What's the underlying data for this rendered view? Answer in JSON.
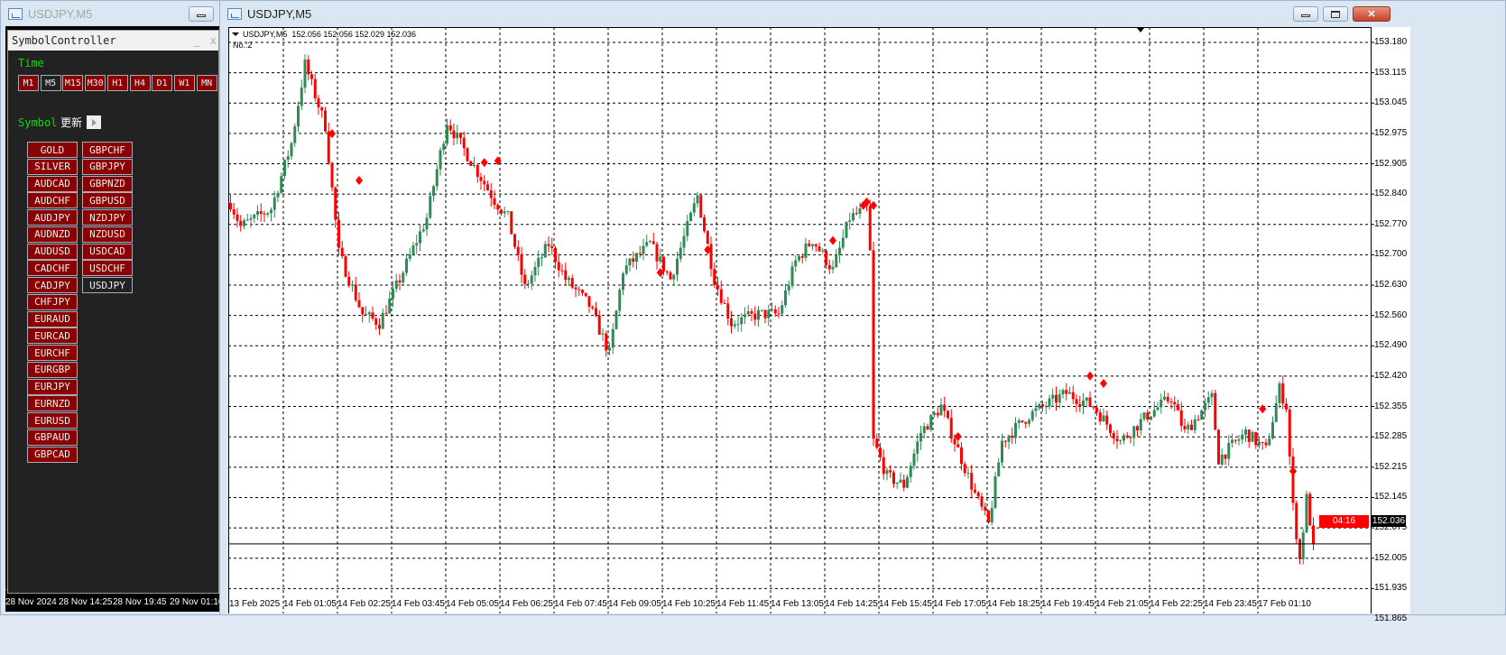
{
  "left_window": {
    "title": "USDJPY,M5",
    "time_labels": [
      "28 Nov 2024",
      "28 Nov 14:25",
      "28 Nov 19:45",
      "29 Nov 01:10"
    ]
  },
  "symbol_controller": {
    "title": "SymbolController",
    "minimize": "_",
    "close": "x",
    "time_label": "Time",
    "timeframes": [
      "M1",
      "M5",
      "M15",
      "M30",
      "H1",
      "H4",
      "D1",
      "W1",
      "MN"
    ],
    "selected_timeframe": "M5",
    "symbol_label": "Symbol",
    "refresh_label": "更新",
    "symbols_col1": [
      "GOLD",
      "SILVER",
      "AUDCAD",
      "AUDCHF",
      "AUDJPY",
      "AUDNZD",
      "AUDUSD",
      "CADCHF",
      "CADJPY",
      "CHFJPY",
      "EURAUD",
      "EURCAD",
      "EURCHF",
      "EURGBP",
      "EURJPY",
      "EURNZD",
      "EURUSD",
      "GBPAUD",
      "GBPCAD"
    ],
    "symbols_col2": [
      "GBPCHF",
      "GBPJPY",
      "GBPNZD",
      "GBPUSD",
      "NZDJPY",
      "NZDUSD",
      "USDCAD",
      "USDCHF",
      "USDJPY"
    ],
    "selected_symbol": "USDJPY"
  },
  "main_window": {
    "title": "USDJPY,M5"
  },
  "chart_data": {
    "type": "candlestick",
    "header": "USDJPY,M5  152.056 152.056 152.029 152.036",
    "sub_header": "No.:2",
    "symbol": "USDJPY",
    "timeframe": "M5",
    "ohlc_last": {
      "open": 152.056,
      "high": 152.056,
      "low": 152.029,
      "close": 152.036
    },
    "current_price": "152.036",
    "countdown": "04:16",
    "grid": true,
    "ylim": [
      151.865,
      153.18
    ],
    "y_ticks": [
      "153.180",
      "153.115",
      "153.045",
      "152.975",
      "152.905",
      "152.840",
      "152.770",
      "152.700",
      "152.630",
      "152.560",
      "152.490",
      "152.420",
      "152.355",
      "152.285",
      "152.215",
      "152.145",
      "152.075",
      "152.005",
      "151.935",
      "151.865"
    ],
    "x_ticks": [
      "13 Feb 2025",
      "14 Feb 01:05",
      "14 Feb 02:25",
      "14 Feb 03:45",
      "14 Feb 05:05",
      "14 Feb 06:25",
      "14 Feb 07:45",
      "14 Feb 09:05",
      "14 Feb 10:25",
      "14 Feb 11:45",
      "14 Feb 13:05",
      "14 Feb 14:25",
      "14 Feb 15:45",
      "14 Feb 17:05",
      "14 Feb 18:25",
      "14 Feb 19:45",
      "14 Feb 21:05",
      "14 Feb 22:25",
      "14 Feb 23:45",
      "17 Feb 01:10"
    ],
    "bars_per_tick": 16,
    "price_path": [
      [
        0,
        152.814
      ],
      [
        3,
        152.76
      ],
      [
        12,
        152.8
      ],
      [
        18,
        152.95
      ],
      [
        22,
        153.13
      ],
      [
        28,
        152.99
      ],
      [
        32,
        152.7
      ],
      [
        39,
        152.56
      ],
      [
        44,
        152.54
      ],
      [
        50,
        152.64
      ],
      [
        58,
        152.78
      ],
      [
        64,
        153.0
      ],
      [
        71,
        152.91
      ],
      [
        78,
        152.82
      ],
      [
        82,
        152.78
      ],
      [
        87,
        152.62
      ],
      [
        94,
        152.72
      ],
      [
        99,
        152.64
      ],
      [
        106,
        152.58
      ],
      [
        112,
        152.47
      ],
      [
        116,
        152.66
      ],
      [
        124,
        152.72
      ],
      [
        130,
        152.64
      ],
      [
        138,
        152.83
      ],
      [
        143,
        152.64
      ],
      [
        148,
        152.54
      ],
      [
        156,
        152.56
      ],
      [
        162,
        152.56
      ],
      [
        167,
        152.68
      ],
      [
        172,
        152.73
      ],
      [
        178,
        152.66
      ],
      [
        183,
        152.78
      ],
      [
        188,
        152.8
      ],
      [
        189,
        152.7
      ],
      [
        190,
        152.27
      ],
      [
        194,
        152.19
      ],
      [
        199,
        152.17
      ],
      [
        204,
        152.29
      ],
      [
        210,
        152.35
      ],
      [
        215,
        152.25
      ],
      [
        220,
        152.15
      ],
      [
        224,
        152.08
      ],
      [
        228,
        152.27
      ],
      [
        236,
        152.33
      ],
      [
        247,
        152.38
      ],
      [
        255,
        152.35
      ],
      [
        263,
        152.27
      ],
      [
        271,
        152.33
      ],
      [
        278,
        152.37
      ],
      [
        282,
        152.29
      ],
      [
        290,
        152.37
      ],
      [
        292,
        152.23
      ],
      [
        300,
        152.29
      ],
      [
        306,
        152.25
      ],
      [
        310,
        152.39
      ],
      [
        312,
        152.35
      ],
      [
        314,
        152.12
      ],
      [
        316,
        152.0
      ],
      [
        318,
        152.14
      ],
      [
        320,
        152.036
      ]
    ],
    "signals": [
      [
        30,
        152.972
      ],
      [
        38,
        152.865
      ],
      [
        75,
        152.906
      ],
      [
        79,
        152.91
      ],
      [
        127,
        152.655
      ],
      [
        141,
        152.707
      ],
      [
        178,
        152.728
      ],
      [
        187,
        152.808
      ],
      [
        188,
        152.816
      ],
      [
        190,
        152.808
      ],
      [
        215,
        152.281
      ],
      [
        254,
        152.419
      ],
      [
        258,
        152.402
      ],
      [
        305,
        152.344
      ],
      [
        314,
        152.202
      ]
    ],
    "colors": {
      "bull": "#2e8b57",
      "bear": "#ff0000",
      "signal": "#ff0000",
      "grid": "#000000",
      "background": "#ffffff"
    }
  }
}
